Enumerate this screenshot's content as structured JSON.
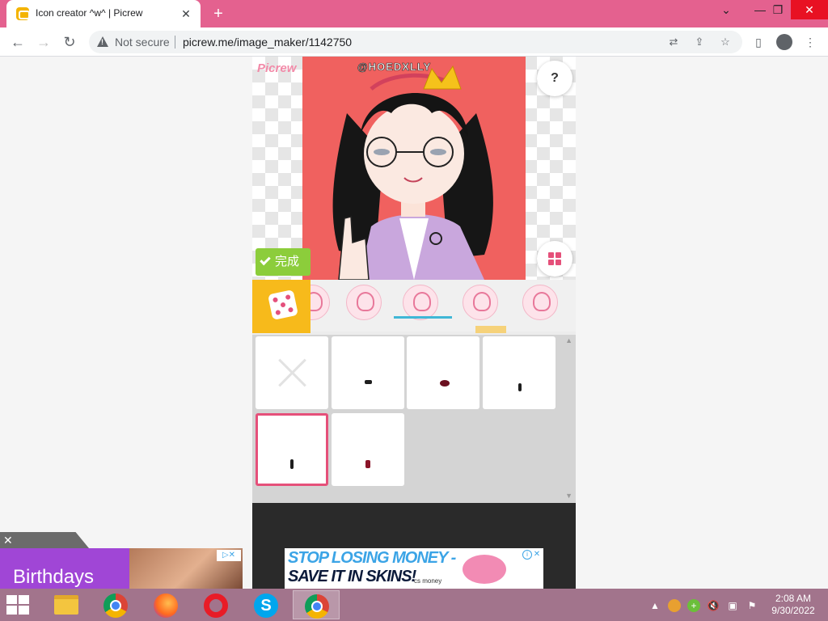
{
  "browser": {
    "tab_title": "Icon creator ^w^ | Picrew",
    "tab_close": "✕",
    "new_tab": "+",
    "security_label": "Not secure",
    "url": "picrew.me/image_maker/1142750"
  },
  "maker": {
    "logo": "Picrew",
    "watermark_username": "@HOEDXLLY",
    "help_label": "?",
    "done_label": "完成",
    "parts_count_visible": 5,
    "items": [
      {
        "id": "none",
        "kind": "none-x"
      },
      {
        "id": "item-2"
      },
      {
        "id": "item-3"
      },
      {
        "id": "item-4"
      },
      {
        "id": "item-5",
        "selected": true
      },
      {
        "id": "item-6"
      }
    ]
  },
  "ads": {
    "banner_line1": "STOP LOSING MONEY -",
    "banner_line2": "SAVE IT IN SKINS!",
    "banner_brand": "cs money",
    "side_ad_text": "Birthdays"
  },
  "taskbar": {
    "time": "2:08 AM",
    "date": "9/30/2022"
  },
  "colors": {
    "titlebar": "#e4618f",
    "portrait_bg": "#f0615f",
    "done_green": "#8ccd3b",
    "dice_yellow": "#f7ba1b",
    "selected_pink": "#e5507a",
    "taskbar": "#a2748c"
  }
}
